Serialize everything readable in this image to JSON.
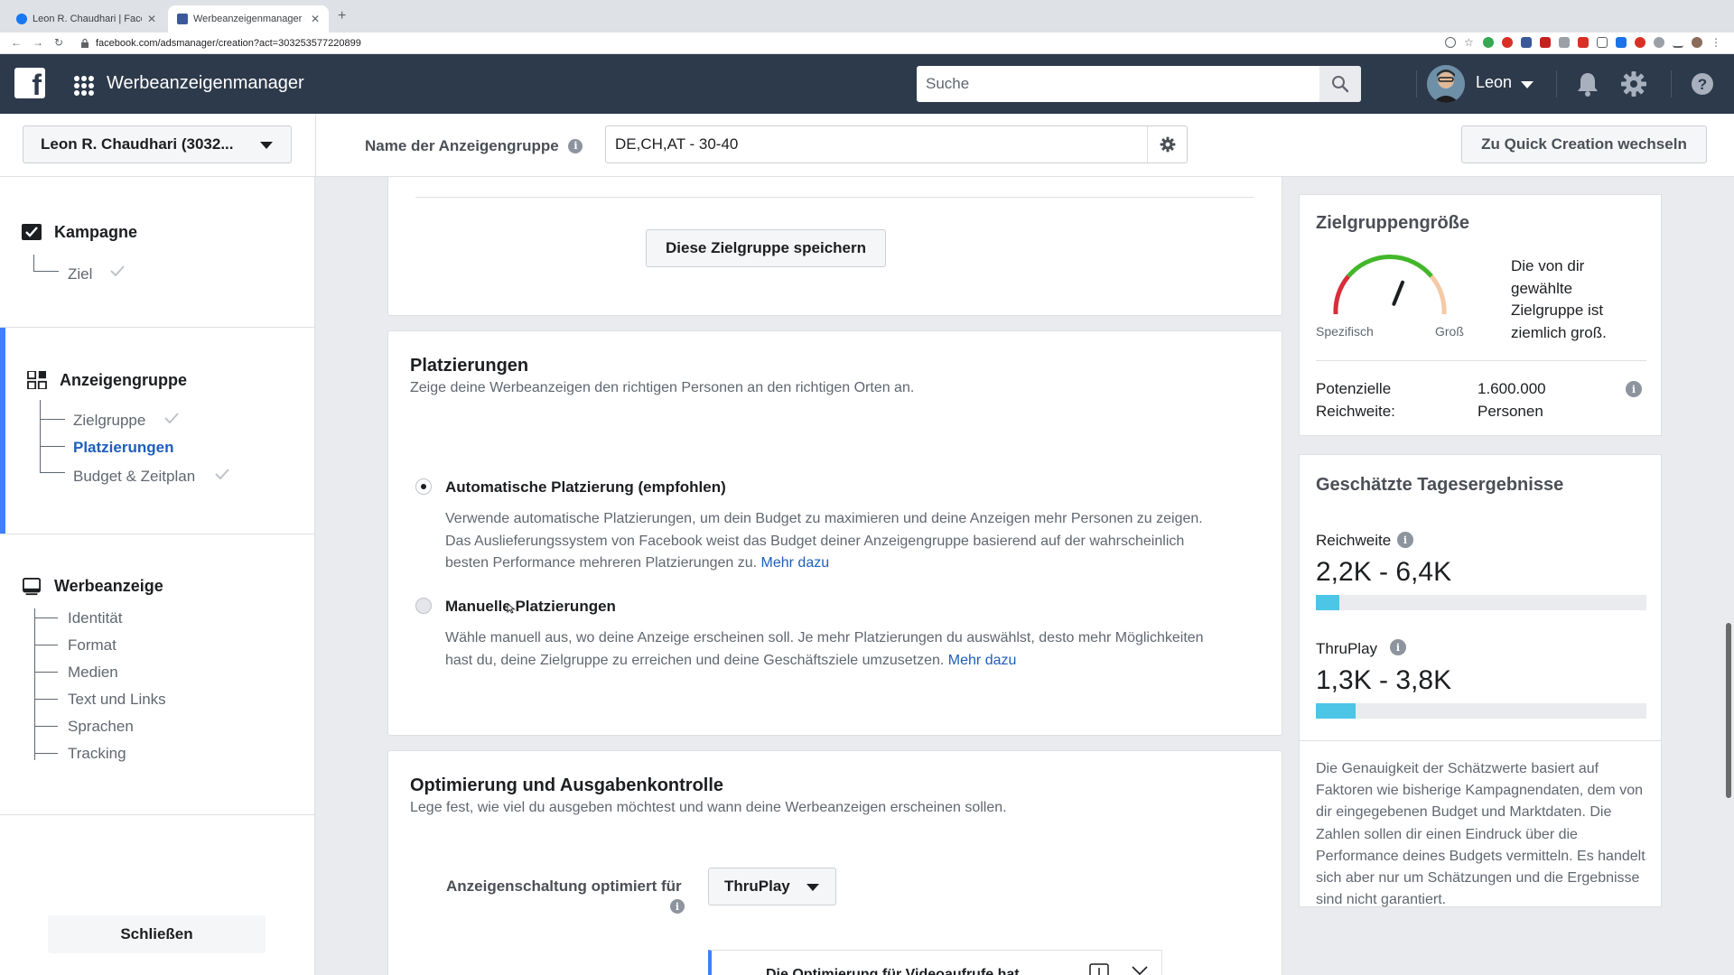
{
  "browser": {
    "tabs": [
      {
        "title": "Leon R. Chaudhari | Facebook",
        "active": false
      },
      {
        "title": "Werbeanzeigenmanager - Cre",
        "active": true
      }
    ],
    "url": "facebook.com/adsmanager/creation?act=303253577220899"
  },
  "topbar": {
    "app_title": "Werbeanzeigenmanager",
    "search_placeholder": "Suche",
    "user_name": "Leon",
    "icons": [
      "facebook-logo-icon",
      "app-grid-icon",
      "search-icon",
      "bell-icon",
      "gear-icon",
      "help-icon"
    ]
  },
  "subheader": {
    "account_label": "Leon R. Chaudhari (3032...",
    "adset_name_label": "Name der Anzeigengruppe",
    "adset_name_value": "DE,CH,AT - 30-40",
    "quick_creation_label": "Zu Quick Creation wechseln"
  },
  "sidebar": {
    "sections": [
      {
        "title": "Kampagne",
        "items": [
          {
            "label": "Ziel",
            "done": true
          }
        ]
      },
      {
        "title": "Anzeigengruppe",
        "items": [
          {
            "label": "Zielgruppe",
            "done": true
          },
          {
            "label": "Platzierungen",
            "current": true
          },
          {
            "label": "Budget & Zeitplan",
            "done": true
          }
        ]
      },
      {
        "title": "Werbeanzeige",
        "items": [
          {
            "label": "Identität"
          },
          {
            "label": "Format"
          },
          {
            "label": "Medien"
          },
          {
            "label": "Text und Links"
          },
          {
            "label": "Sprachen"
          },
          {
            "label": "Tracking"
          }
        ]
      }
    ],
    "close_label": "Schließen"
  },
  "main": {
    "save_audience_label": "Diese Zielgruppe speichern",
    "placements": {
      "title": "Platzierungen",
      "subtitle": "Zeige deine Werbeanzeigen den richtigen Personen an den richtigen Orten an.",
      "auto": {
        "label": "Automatische Platzierung (empfohlen)",
        "desc": "Verwende automatische Platzierungen, um dein Budget zu maximieren und deine Anzeigen mehr Personen zu zeigen. Das Auslieferungssystem von Facebook weist das Budget deiner Anzeigengruppe basierend auf der wahrscheinlich besten Performance mehreren Platzierungen zu.",
        "link": "Mehr dazu",
        "selected": true
      },
      "manual": {
        "label": "Manuelle Platzierungen",
        "desc": "Wähle manuell aus, wo deine Anzeige erscheinen soll. Je mehr Platzierungen du auswählst, desto mehr Möglichkeiten hast du, deine Zielgruppe zu erreichen und deine Geschäftsziele umzusetzen.",
        "link": "Mehr dazu",
        "selected": false
      }
    },
    "optimization": {
      "title": "Optimierung und Ausgabenkontrolle",
      "subtitle": "Lege fest, wie viel du ausgeben möchtest und wann deine Werbeanzeigen erscheinen sollen.",
      "delivery_label": "Anzeigenschaltung optimiert für",
      "delivery_value": "ThruPlay",
      "notice_text": "Die Optimierung für Videoaufrufe hat"
    }
  },
  "right": {
    "audience": {
      "title": "Zielgruppengröße",
      "gauge_left": "Spezifisch",
      "gauge_right": "Groß",
      "gauge_level": 0.62,
      "desc": "Die von dir gewählte Zielgruppe ist ziemlich groß.",
      "reach_label": "Potenzielle Reichweite:",
      "reach_value": "1.600.000 Personen"
    },
    "daily": {
      "title": "Geschätzte Tagesergebnisse",
      "reach_label": "Reichweite",
      "reach_value": "2,2K - 6,4K",
      "reach_fill": 0.07,
      "thruplay_label": "ThruPlay",
      "thruplay_value": "1,3K - 3,8K",
      "thruplay_fill": 0.12,
      "note": "Die Genauigkeit der Schätzwerte basiert auf Faktoren wie bisherige Kampagnendaten, dem von dir eingegebenen Budget und Marktdaten. Die Zahlen sollen dir einen Eindruck über die Performance deines Budgets vermitteln. Es handelt sich aber nur um Schätzungen und die Ergebnisse sind nicht garantiert."
    }
  },
  "colors": {
    "topbar": "#2d3a4b",
    "accent": "#4080ff",
    "link": "#1d5ebd",
    "bar_fill": "#4cc5e6",
    "gauge_green": "#42b72a",
    "gauge_red": "#d92d3a"
  }
}
